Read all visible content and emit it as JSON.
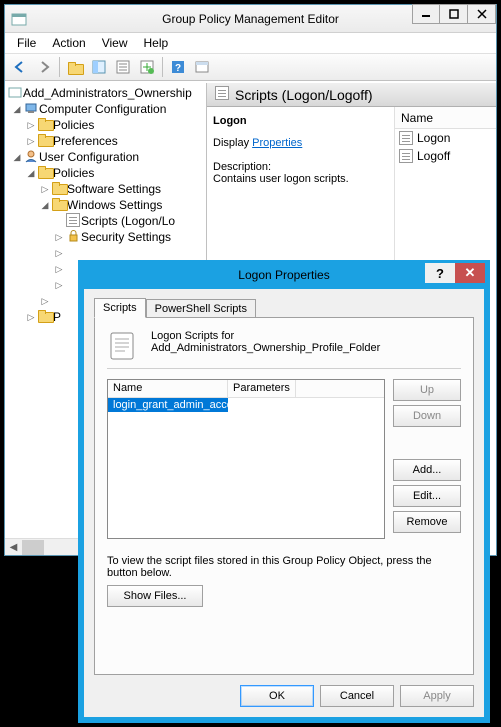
{
  "main_window": {
    "title": "Group Policy Management Editor",
    "menu": {
      "file": "File",
      "action": "Action",
      "view": "View",
      "help": "Help"
    }
  },
  "tree": {
    "root": "Add_Administrators_Ownership",
    "computer_config": "Computer Configuration",
    "cc_policies": "Policies",
    "cc_prefs": "Preferences",
    "user_config": "User Configuration",
    "uc_policies": "Policies",
    "software": "Software Settings",
    "windows": "Windows Settings",
    "scripts": "Scripts (Logon/Lo",
    "security": "Security Settings",
    "p_label": "P"
  },
  "right": {
    "header": "Scripts (Logon/Logoff)",
    "sel_title": "Logon",
    "display_label": "Display",
    "properties_link": "Properties",
    "desc_label": "Description:",
    "desc_text": "Contains user logon scripts.",
    "col_name": "Name",
    "item_logon": "Logon",
    "item_logoff": "Logoff"
  },
  "dialog": {
    "title": "Logon Properties",
    "tab_scripts": "Scripts",
    "tab_ps": "PowerShell Scripts",
    "header_line1": "Logon Scripts for",
    "header_line2": "Add_Administrators_Ownership_Profile_Folder",
    "col_name": "Name",
    "col_params": "Parameters",
    "row1_name": "login_grant_admin_acce...",
    "btn_up": "Up",
    "btn_down": "Down",
    "btn_add": "Add...",
    "btn_edit": "Edit...",
    "btn_remove": "Remove",
    "footer_text": "To view the script files stored in this Group Policy Object, press the button below.",
    "btn_showfiles": "Show Files...",
    "btn_ok": "OK",
    "btn_cancel": "Cancel",
    "btn_apply": "Apply"
  }
}
